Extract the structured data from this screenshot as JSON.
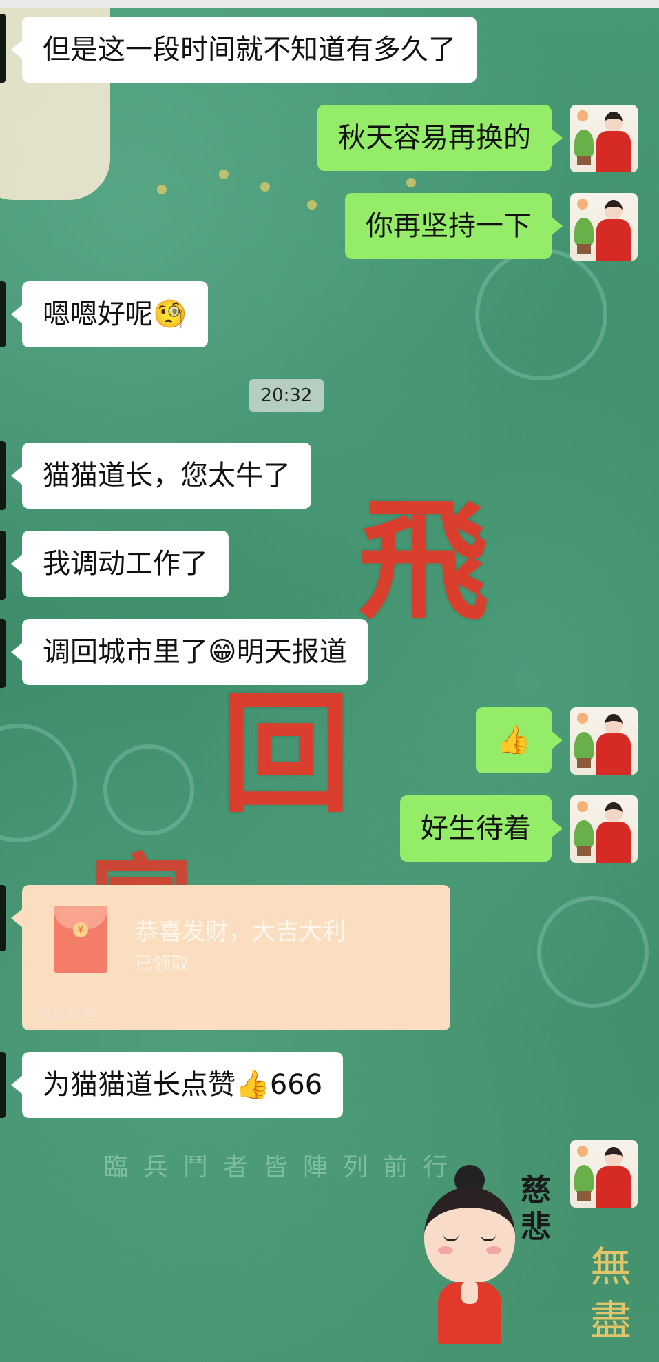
{
  "messages": [
    {
      "side": "left",
      "text": "但是这一段时间就不知道有多久了"
    },
    {
      "side": "right",
      "text": "秋天容易再换的"
    },
    {
      "side": "right",
      "text": "你再坚持一下"
    },
    {
      "side": "left",
      "text": "嗯嗯好呢",
      "emoji": "🧐"
    },
    {
      "side": "left",
      "text": "猫猫道长，您太牛了"
    },
    {
      "side": "left",
      "text": "我调动工作了"
    },
    {
      "side": "left",
      "text": "调回城市里了",
      "emoji": "😁",
      "text_after": "明天报道"
    },
    {
      "side": "right",
      "emoji": "👍"
    },
    {
      "side": "right",
      "text": "好生待着"
    },
    {
      "side": "left",
      "text": "为猫猫道长点赞",
      "emoji": "👍",
      "text_after": "666"
    }
  ],
  "timestamp": "20:32",
  "red_packet": {
    "title": "恭喜发财，大吉大利",
    "status": "已领取",
    "footer": "微信红包",
    "coin_symbol": "¥"
  },
  "sticker": {
    "text": "慈悲"
  },
  "background": {
    "calligraphy": [
      "飛",
      "回",
      "家"
    ],
    "faint_text": "臨兵鬥者皆陣列前行",
    "vertical_text": "無盡"
  },
  "colors": {
    "bubble_self": "#95ec69",
    "bubble_other": "#ffffff",
    "red_packet": "#fbddc0",
    "background": "#3f8f6c"
  }
}
